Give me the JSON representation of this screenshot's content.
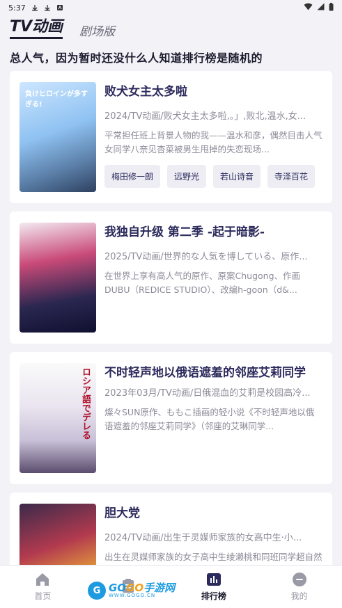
{
  "status": {
    "time": "5:37"
  },
  "tabs": [
    {
      "label": "TV动画",
      "active": true
    },
    {
      "label": "剧场版",
      "active": false
    }
  ],
  "notice": "总人气，因为暂时还没什么人知道排行榜是随机的",
  "items": [
    {
      "title": "败犬女主太多啦",
      "cover_text": "負けヒロインが多すぎる!",
      "meta": "2024/TV动画/败犬女主太多啦,。」,败北,温水,女...",
      "desc": "平常担任班上背景人物的我——温水和彦，偶然目击人气女同学八奈见杏菜被男生甩掉的失恋现场...",
      "tags": [
        "梅田修一朗",
        "远野光",
        "若山诗音",
        "寺泽百花"
      ]
    },
    {
      "title": "我独自升级 第二季 -起于暗影-",
      "cover_text": "",
      "meta": "2025/TV动画/世界的な人気を博している、原作...",
      "desc": "在世界上享有高人气的原作、原案Chugong、作画DUBU（REDICE STUDIO）、改编h-goon（d&...",
      "tags": []
    },
    {
      "title": "不时轻声地以俄语遮羞的邻座艾莉同学",
      "cover_text": "ロシア語でデレる",
      "meta": "2023年03月/TV动画/日俄混血的艾莉是校园高冷...",
      "desc": "燦々SUN原作、ももこ插画的轻小说《不时轻声地以俄语遮羞的邻座艾莉同学》（邻座的艾琳同学...",
      "tags": []
    },
    {
      "title": "胆大党",
      "cover_text": "",
      "meta": "2024/TV动画/出生于灵媒师家族的女高中生·小...",
      "desc": "出生在灵媒师家族的女子高中生绫濑桃和同班同学超自然狂热者高仓健，某一次在打赌谁信的...",
      "tags": []
    }
  ],
  "nav": [
    {
      "label": "首页",
      "icon": "home-icon",
      "active": false
    },
    {
      "label": "",
      "icon": "clipboard-icon",
      "active": false
    },
    {
      "label": "排行榜",
      "icon": "bar-chart-icon",
      "active": true
    },
    {
      "label": "我的",
      "icon": "profile-icon",
      "active": false
    }
  ],
  "watermark": {
    "main_a": "GO",
    "main_b": "GO",
    "main_c": "手游网",
    "sub": "WWW.GOGO.CN",
    "badge": "G"
  }
}
